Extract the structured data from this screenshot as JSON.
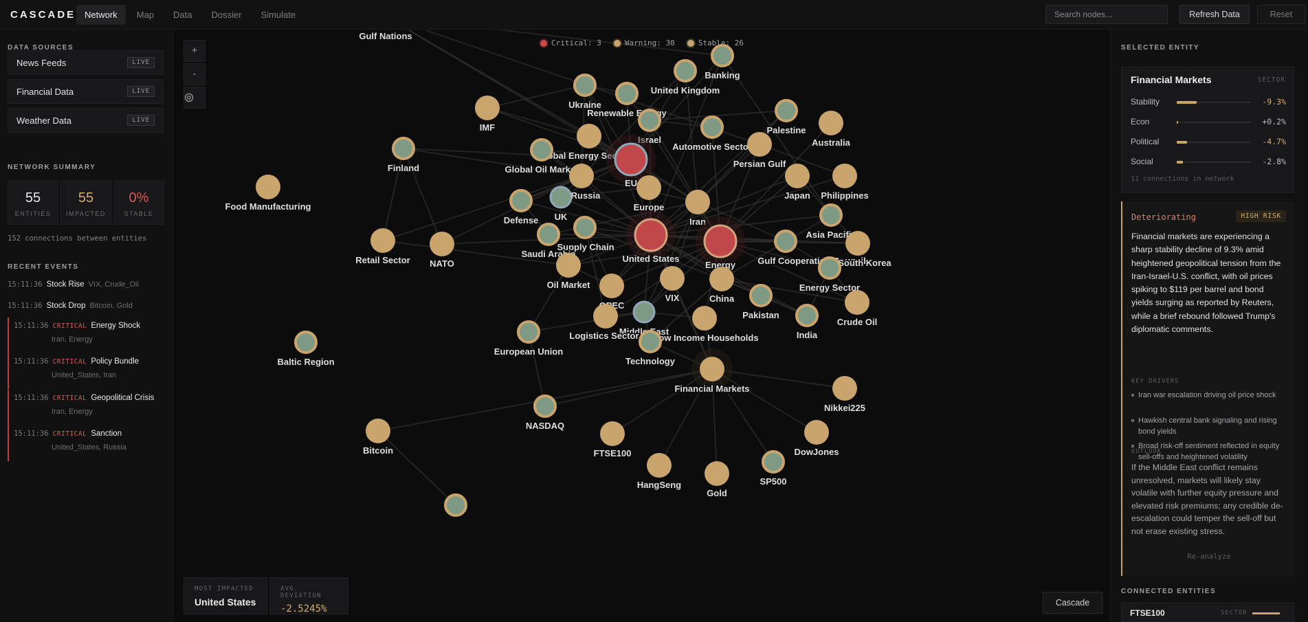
{
  "app": {
    "logo": "CASCADE",
    "tabs": [
      "Network",
      "Map",
      "Data",
      "Dossier",
      "Simulate"
    ],
    "active_tab": 0,
    "search_placeholder": "Search nodes...",
    "refresh_label": "Refresh Data",
    "reset_label": "Reset"
  },
  "left": {
    "sources_title": "DATA SOURCES",
    "sources": [
      {
        "label": "News Feeds",
        "badge": "LIVE"
      },
      {
        "label": "Financial Data",
        "badge": "LIVE"
      },
      {
        "label": "Weather Data",
        "badge": "LIVE"
      }
    ],
    "summary_title": "NETWORK SUMMARY",
    "stats": [
      {
        "value": "55",
        "label": "ENTITIES",
        "color": "#e8e8e8"
      },
      {
        "value": "55",
        "label": "IMPACTED",
        "color": "#d4ab70"
      },
      {
        "value": "0%",
        "label": "STABLE",
        "color": "#d85a57"
      }
    ],
    "connections_note": "152 connections between entities",
    "events_title": "RECENT EVENTS",
    "events": [
      {
        "time": "15:11:36",
        "type": "Stock Rise",
        "entities": "VIX, Crude_Oil",
        "critical": false
      },
      {
        "time": "15:11:36",
        "type": "Stock Drop",
        "entities": "Bitcoin, Gold",
        "critical": false
      },
      {
        "time": "15:11:36",
        "type": "Energy Shock",
        "entities": "Iran, Energy",
        "critical": true,
        "tag": "CRITICAL"
      },
      {
        "time": "15:11:36",
        "type": "Policy Bundle",
        "entities": "United_States, Iran",
        "critical": true,
        "tag": "CRITICAL"
      },
      {
        "time": "15:11:36",
        "type": "Geopolitical Crisis",
        "entities": "Iran, Energy",
        "critical": true,
        "tag": "CRITICAL"
      },
      {
        "time": "15:11:36",
        "type": "Sanction",
        "entities": "United_States, Russia",
        "critical": true,
        "tag": "CRITICAL"
      }
    ]
  },
  "graph": {
    "zoom_in": "+",
    "zoom_out": "-",
    "recenter_icon": "target-icon",
    "legend": [
      {
        "label": "Critical: 3",
        "color": "#c94a48"
      },
      {
        "label": "Warning: 30",
        "color": "#c9a46c"
      },
      {
        "label": "Stable: 26",
        "color": "#c9a46c"
      }
    ],
    "most_impacted_label": "MOST IMPACTED",
    "most_impacted_value": "United States",
    "avg_deviation_label": "AVG. DEVIATION",
    "avg_deviation_value": "-2.5245%",
    "cascade_label": "Cascade",
    "colors": {
      "warning": "#c9a46c",
      "critical": "#c0474a",
      "stable_ring": "#7d9a86",
      "edge": "#3a3735"
    },
    "nodes": [
      {
        "id": "gulf-nations",
        "label": "Gulf Nations",
        "status": "stable"
      },
      {
        "id": "banking",
        "label": "Banking",
        "status": "stable"
      },
      {
        "id": "united-kingdom",
        "label": "United Kingdom",
        "status": "stable"
      },
      {
        "id": "ukraine",
        "label": "Ukraine",
        "status": "stable"
      },
      {
        "id": "renewable-energy",
        "label": "Renewable Energy",
        "status": "stable"
      },
      {
        "id": "imf",
        "label": "IMF",
        "status": "warning"
      },
      {
        "id": "palestine",
        "label": "Palestine",
        "status": "stable"
      },
      {
        "id": "australia",
        "label": "Australia",
        "status": "warning"
      },
      {
        "id": "israel",
        "label": "Israel",
        "status": "stable"
      },
      {
        "id": "automotive-sector",
        "label": "Automotive Sector",
        "status": "stable"
      },
      {
        "id": "global-energy-sector",
        "label": "Global Energy Sector",
        "status": "warning"
      },
      {
        "id": "finland",
        "label": "Finland",
        "status": "stable"
      },
      {
        "id": "persian-gulf",
        "label": "Persian Gulf",
        "status": "warning"
      },
      {
        "id": "global-oil-market",
        "label": "Global Oil Market",
        "status": "stable"
      },
      {
        "id": "eu",
        "label": "EU",
        "status": "critical"
      },
      {
        "id": "japan",
        "label": "Japan",
        "status": "warning"
      },
      {
        "id": "philippines",
        "label": "Philippines",
        "status": "warning"
      },
      {
        "id": "russia",
        "label": "Russia",
        "status": "warning"
      },
      {
        "id": "food-manufacturing",
        "label": "Food Manufacturing",
        "status": "warning"
      },
      {
        "id": "europe",
        "label": "Europe",
        "status": "warning"
      },
      {
        "id": "defense",
        "label": "Defense",
        "status": "stable"
      },
      {
        "id": "uk",
        "label": "UK",
        "status": "stable"
      },
      {
        "id": "iran",
        "label": "Iran",
        "status": "warning"
      },
      {
        "id": "asia-pacific",
        "label": "Asia Pacific",
        "status": "stable"
      },
      {
        "id": "supply-chain",
        "label": "Supply Chain",
        "status": "stable"
      },
      {
        "id": "saudi-arabia",
        "label": "Saudi Arabia",
        "status": "stable"
      },
      {
        "id": "retail-sector",
        "label": "Retail Sector",
        "status": "warning"
      },
      {
        "id": "nato",
        "label": "NATO",
        "status": "warning"
      },
      {
        "id": "united-states",
        "label": "United States",
        "status": "critical"
      },
      {
        "id": "energy",
        "label": "Energy",
        "status": "critical"
      },
      {
        "id": "gcc",
        "label": "Gulf Cooperation Council",
        "status": "stable"
      },
      {
        "id": "south-korea",
        "label": "South Korea",
        "status": "warning"
      },
      {
        "id": "oil-market",
        "label": "Oil Market",
        "status": "warning"
      },
      {
        "id": "energy-sector",
        "label": "Energy Sector",
        "status": "stable"
      },
      {
        "id": "vix",
        "label": "VIX",
        "status": "warning"
      },
      {
        "id": "opec",
        "label": "OPEC",
        "status": "warning"
      },
      {
        "id": "china",
        "label": "China",
        "status": "warning"
      },
      {
        "id": "pakistan",
        "label": "Pakistan",
        "status": "stable"
      },
      {
        "id": "crude-oil",
        "label": "Crude Oil",
        "status": "warning"
      },
      {
        "id": "middle-east",
        "label": "Middle East",
        "status": "stable"
      },
      {
        "id": "logistics-sector",
        "label": "Logistics Sector",
        "status": "warning"
      },
      {
        "id": "low-income-households",
        "label": "Low Income Households",
        "status": "warning"
      },
      {
        "id": "india",
        "label": "India",
        "status": "stable"
      },
      {
        "id": "european-union",
        "label": "European Union",
        "status": "stable"
      },
      {
        "id": "technology",
        "label": "Technology",
        "status": "stable"
      },
      {
        "id": "baltic-region",
        "label": "Baltic Region",
        "status": "stable"
      },
      {
        "id": "financial-markets",
        "label": "Financial Markets",
        "status": "warning"
      },
      {
        "id": "nikkei225",
        "label": "Nikkei225",
        "status": "warning"
      },
      {
        "id": "nasdaq",
        "label": "NASDAQ",
        "status": "stable"
      },
      {
        "id": "bitcoin",
        "label": "Bitcoin",
        "status": "warning"
      },
      {
        "id": "ftse100",
        "label": "FTSE100",
        "status": "warning"
      },
      {
        "id": "dowjones",
        "label": "DowJones",
        "status": "warning"
      },
      {
        "id": "hangseng",
        "label": "HangSeng",
        "status": "warning"
      },
      {
        "id": "gold",
        "label": "Gold",
        "status": "warning"
      },
      {
        "id": "sp500",
        "label": "SP500",
        "status": "stable"
      },
      {
        "id": "bottom-node",
        "label": "",
        "status": "stable"
      }
    ]
  },
  "right": {
    "selected_title": "SELECTED ENTITY",
    "entity": {
      "name": "Financial Markets",
      "type": "SECTOR",
      "metrics": [
        {
          "name": "Stability",
          "value": "-9.3%",
          "level": 0.27,
          "color": "#d4ab70"
        },
        {
          "name": "Econ",
          "value": "+0.2%",
          "level": 0.01,
          "color": "#bdbdc0"
        },
        {
          "name": "Political",
          "value": "-4.7%",
          "level": 0.14,
          "color": "#d4ab70"
        },
        {
          "name": "Social",
          "value": "-2.8%",
          "level": 0.08,
          "color": "#bdbdc0"
        }
      ],
      "connections_note": "11 connections in network"
    },
    "analysis": {
      "trend": "Deteriorating",
      "risk": "HIGH RISK",
      "summary": "Financial markets are experiencing a sharp stability decline of 9.3% amid heightened geopolitical tension from the Iran-Israel-U.S. conflict, with oil prices spiking to $119 per barrel and bond yields surging as reported by Reuters, while a brief rebound followed Trump's diplomatic comments.",
      "drivers_title": "KEY DRIVERS",
      "drivers": [
        "Iran war escalation driving oil price shock",
        "Hawkish central bank signaling and rising bond yields",
        "Broad risk-off sentiment reflected in equity sell-offs and heightened volatility"
      ],
      "outlook_title": "OUTLOOK",
      "outlook": "If the Middle East conflict remains unresolved, markets will likely stay volatile with further equity pressure and elevated risk premiums; any credible de-escalation could temper the sell-off but not erase existing stress.",
      "reanalyze": "Re-analyze"
    },
    "connected_title": "CONNECTED ENTITIES",
    "connected": [
      {
        "name": "FTSE100",
        "type": "SECTOR"
      }
    ]
  }
}
